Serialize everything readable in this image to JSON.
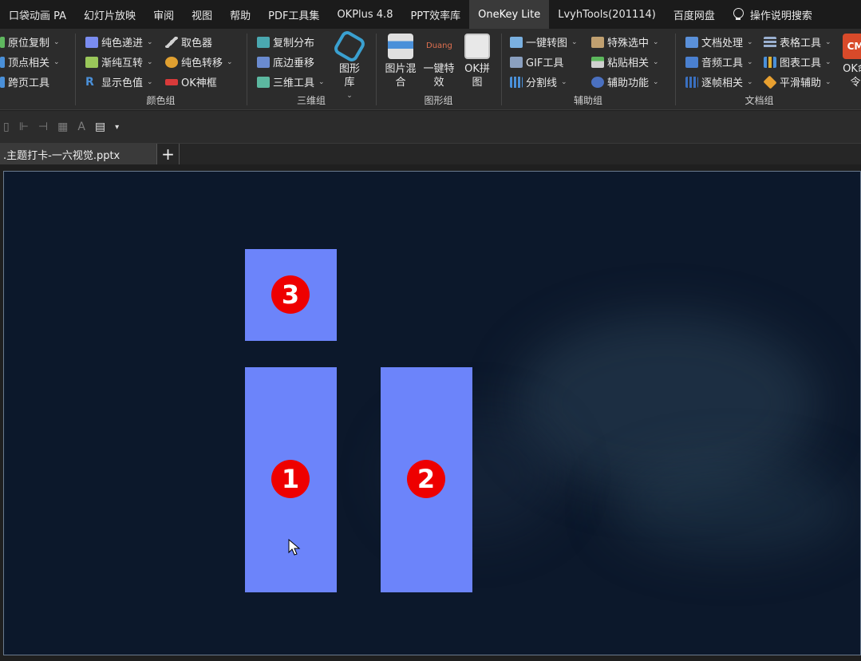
{
  "menu": {
    "tabs": [
      "口袋动画 PA",
      "幻灯片放映",
      "审阅",
      "视图",
      "帮助",
      "PDF工具集",
      "OKPlus 4.8",
      "PPT效率库",
      "OneKey Lite",
      "LvyhTools(201114)",
      "百度网盘"
    ],
    "active_tab": "OneKey Lite",
    "search_label": "操作说明搜索"
  },
  "ribbon": {
    "group0": {
      "items": [
        "原位复制",
        "顶点相关",
        "跨页工具"
      ]
    },
    "color_group": {
      "label": "颜色组",
      "col1": [
        "纯色递进",
        "渐纯互转",
        "显示色值"
      ],
      "col2": [
        "取色器",
        "纯色转移",
        "OK神框"
      ]
    },
    "three_d_group": {
      "label": "三维组",
      "items": [
        "复制分布",
        "底边垂移",
        "三维工具"
      ],
      "big_label": "图形库"
    },
    "shape_group": {
      "label": "图形组",
      "big_items": [
        "图片混合",
        "一键特效",
        "OK拼图"
      ],
      "duang_text": "Duang"
    },
    "aux_group": {
      "label": "辅助组",
      "col1": [
        "一键转图",
        "GIF工具",
        "分割线"
      ],
      "col2": [
        "特殊选中",
        "粘贴相关",
        "辅助功能"
      ]
    },
    "doc_group": {
      "label": "文档组",
      "col1": [
        "文档处理",
        "音频工具",
        "逐帧相关"
      ],
      "col2": [
        "表格工具",
        "图表工具",
        "平滑辅助"
      ],
      "cmd_icon_text": "CM",
      "cmd_label": "OK命令"
    }
  },
  "qat": {
    "font_letter": "A",
    "more": "▾"
  },
  "doc_tab": {
    "title": ".主题打卡-一六视觉.pptx",
    "add": "+"
  },
  "slide": {
    "background": "#0c182b",
    "bar_color": "#6c84fa",
    "badge_color": "#ee0000",
    "badges": [
      "3",
      "1",
      "2"
    ]
  }
}
